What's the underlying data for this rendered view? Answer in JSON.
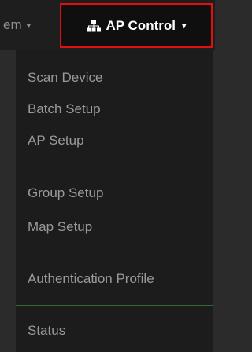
{
  "navbar": {
    "prev_label": "em",
    "active_label": "AP Control",
    "active_icon": "sitemap-icon",
    "caret_glyph": "▾"
  },
  "menu": {
    "items": [
      {
        "label": "Scan Device"
      },
      {
        "label": "Batch Setup"
      },
      {
        "label": "AP Setup"
      },
      {
        "label": "Group Setup"
      },
      {
        "label": "Map Setup"
      },
      {
        "label": "Authentication Profile"
      },
      {
        "label": "Status"
      }
    ]
  },
  "colors": {
    "active_border": "#e01010",
    "divider": "#2e6b2e",
    "menu_bg": "#1c1c1c",
    "text": "#9a9a9a"
  }
}
